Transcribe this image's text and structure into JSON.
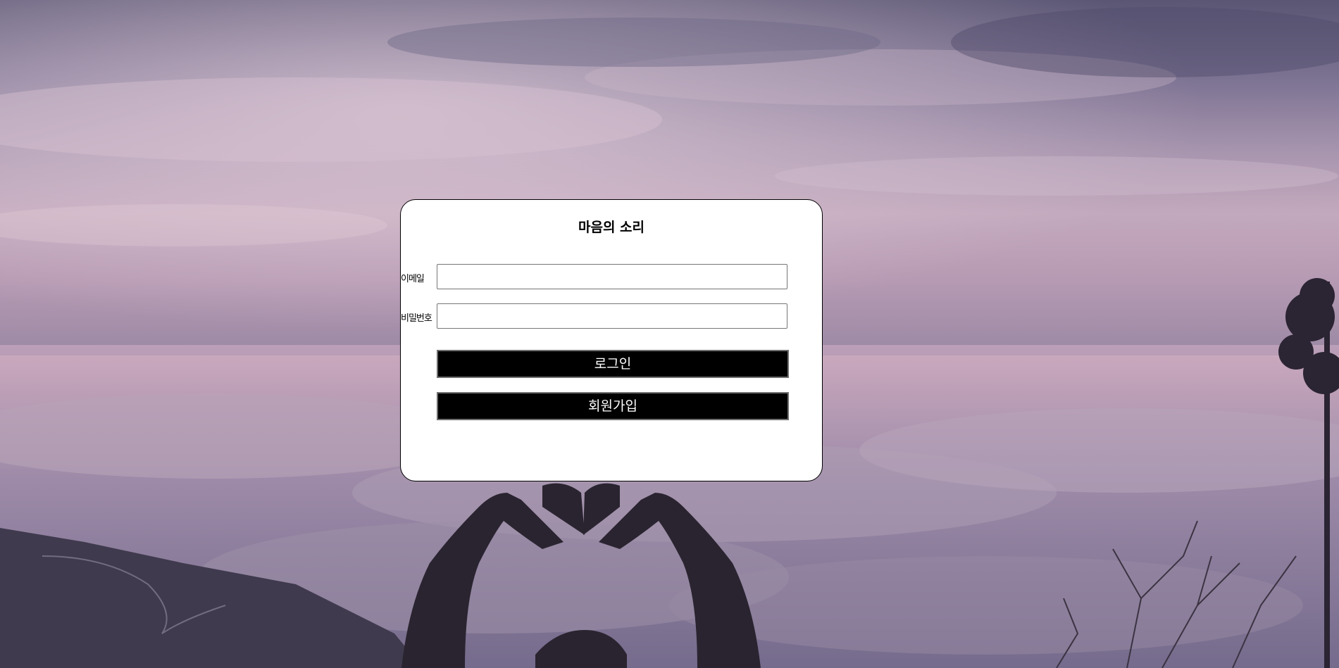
{
  "app": {
    "title": "마음의 소리"
  },
  "login_form": {
    "email_label": "이메일",
    "email_value": "",
    "password_label": "비밀번호",
    "password_value": "",
    "login_button": "로그인",
    "signup_button": "회원가입"
  },
  "colors": {
    "card_background": "#ffffff",
    "button_background": "#000000",
    "button_text": "#ffffff"
  }
}
